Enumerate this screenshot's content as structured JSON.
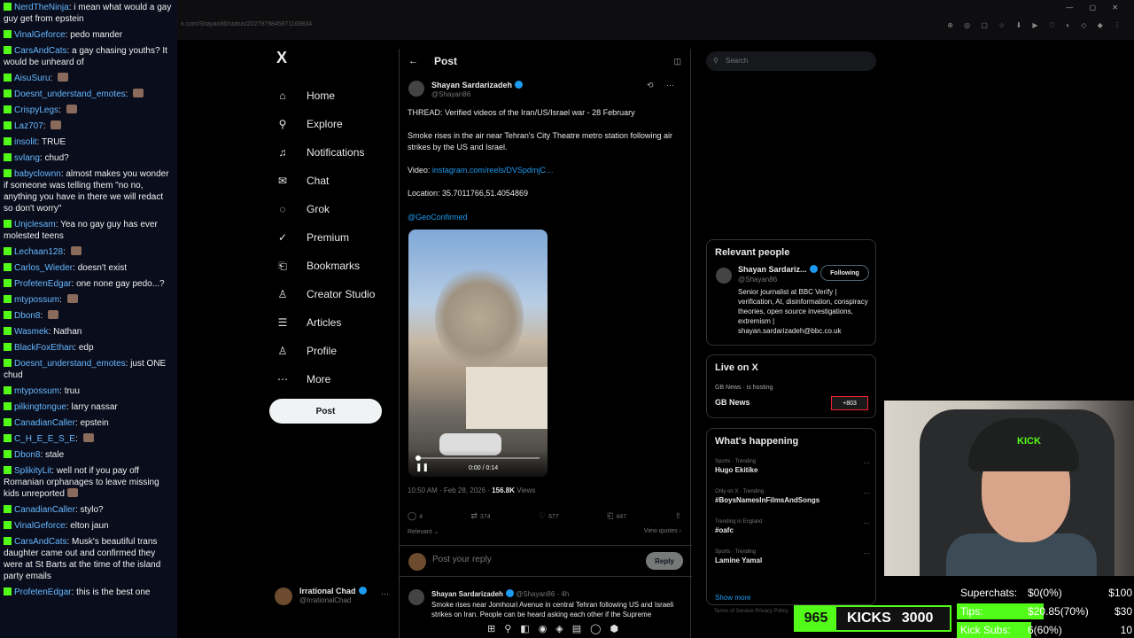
{
  "chat": [
    {
      "user": "NerdTheNinja",
      "text": "i mean what would a gay guy get from epstein",
      "emote": false
    },
    {
      "user": "VinalGeforce",
      "text": "pedo mander",
      "emote": false
    },
    {
      "user": "CarsAndCats",
      "text": "a gay chasing youths? It would be unheard of",
      "emote": false
    },
    {
      "user": "AisuSuru",
      "text": "",
      "emote": true
    },
    {
      "user": "Doesnt_understand_emotes",
      "text": "",
      "emote": true
    },
    {
      "user": "CrispyLegs",
      "text": "",
      "emote": true
    },
    {
      "user": "Laz707",
      "text": "",
      "emote": true
    },
    {
      "user": "insolit",
      "text": "TRUE",
      "emote": false
    },
    {
      "user": "svlang",
      "text": "chud?",
      "emote": false
    },
    {
      "user": "babyclownn",
      "text": "almost makes you wonder if someone was telling them \"no no, anything you have in there we will redact so don't worry\"",
      "emote": false
    },
    {
      "user": "Unjclesam",
      "text": "Yea no gay guy has ever molested teens",
      "emote": false
    },
    {
      "user": "Lechaan128",
      "text": "",
      "emote": true
    },
    {
      "user": "Carlos_Wieder",
      "text": "doesn't exist",
      "emote": false
    },
    {
      "user": "ProfetenEdgar",
      "text": "one none gay pedo...?",
      "emote": false
    },
    {
      "user": "mtypossum",
      "text": "",
      "emote": true
    },
    {
      "user": "Dbon8",
      "text": "",
      "emote": true
    },
    {
      "user": "Wasmek",
      "text": "Nathan",
      "emote": false
    },
    {
      "user": "BlackFoxEthan",
      "text": "edp",
      "emote": false
    },
    {
      "user": "Doesnt_understand_emotes",
      "text": "just ONE chud",
      "emote": false
    },
    {
      "user": "mtypossum",
      "text": "truu",
      "emote": false
    },
    {
      "user": "pilkingtongue",
      "text": "larry nassar",
      "emote": false
    },
    {
      "user": "CanadianCaller",
      "text": "epstein",
      "emote": false
    },
    {
      "user": "C_H_E_E_S_E",
      "text": "",
      "emote": true
    },
    {
      "user": "Dbon8",
      "text": "stale",
      "emote": false
    },
    {
      "user": "SplikityLit",
      "text": "well not if you pay off Romanian orphanages to leave missing kids unreported",
      "emote": true
    },
    {
      "user": "CanadianCaller",
      "text": "stylo?",
      "emote": false
    },
    {
      "user": "VinalGeforce",
      "text": "elton jaun",
      "emote": false
    },
    {
      "user": "CarsAndCats",
      "text": "Musk's beautiful trans daughter came out and confirmed they were at St Barts at the time of the island party emails",
      "emote": false
    },
    {
      "user": "ProfetenEdgar",
      "text": "this is the best one",
      "emote": false
    }
  ],
  "browser": {
    "url": "x.com/Shayan86/status/2027979845871169834",
    "toolbar_icons": "⊕ ◎ ▢ ☆ ⬇ ▶ ♡ ◐ ◇ ◆ ⋮",
    "window_controls": "— ▢ ✕"
  },
  "nav": {
    "logo": "X",
    "items": [
      {
        "label": "Home",
        "icon": "⌂"
      },
      {
        "label": "Explore",
        "icon": "⚲"
      },
      {
        "label": "Notifications",
        "icon": "♫"
      },
      {
        "label": "Chat",
        "icon": "✉"
      },
      {
        "label": "Grok",
        "icon": "◌"
      },
      {
        "label": "Premium",
        "icon": "✓"
      },
      {
        "label": "Bookmarks",
        "icon": "⎗"
      },
      {
        "label": "Creator Studio",
        "icon": "♙"
      },
      {
        "label": "Articles",
        "icon": "☰"
      },
      {
        "label": "Profile",
        "icon": "♙"
      },
      {
        "label": "More",
        "icon": "⋯"
      }
    ],
    "post_button": "Post",
    "account_name": "Irrational Chad",
    "account_handle": "@IrrationalChad"
  },
  "post": {
    "header_title": "Post",
    "back": "←",
    "reader": "◫",
    "author_name": "Shayan Sardarizadeh",
    "author_handle": "@Shayan86",
    "author_icons": "⟲ ⋯",
    "line1": "THREAD: Verified videos of the Iran/US/Israel war - 28 February",
    "line2": "Smoke rises in the air near Tehran's City Theatre metro station following air strikes by the US and Israel.",
    "video_label": "Video: ",
    "video_link": "instagram.com/reels/DVSpdmjC…",
    "location": "Location: 35.7011766,51.4054869",
    "mention": "@GeoConfirmed",
    "video_time": "0:00 / 0:14",
    "video_pause": "❚❚",
    "timestamp": "10:50 AM · Feb 28, 2026 · ",
    "views_count": "156.8K",
    "views_label": " Views",
    "replies": "4",
    "reposts": "374",
    "likes": "677",
    "bookmarks": "447",
    "relevant": "Relevant ⌄",
    "view_quotes": "View quotes ›",
    "reply_placeholder": "Post your reply",
    "reply_button": "Reply",
    "next_name": "Shayan Sardarizadeh",
    "next_meta": " @Shayan86 · 4h",
    "next_text": "Smoke rises near Jomhouri Avenue in central Tehran following US and Israeli strikes on Iran. People can be heard asking each other if the Supreme"
  },
  "right": {
    "search_placeholder": "Search",
    "relevant_title": "Relevant people",
    "rp_name": "Shayan Sardariz...",
    "rp_handle": "@Shayan86",
    "rp_follow": "Following",
    "rp_bio": "Senior journalist at BBC Verify | verification, AI, disinformation, conspiracy theories, open source investigations, extremism | shayan.sardarizadeh@bbc.co.uk",
    "live_title": "Live on X",
    "live_source": "GB News · is hosting",
    "live_name": "GB News",
    "live_count": "+803",
    "happening_title": "What's happening",
    "trends": [
      {
        "ctx": "Sports · Trending",
        "title": "Hugo Ekitike"
      },
      {
        "ctx": "Only on X · Trending",
        "title": "#BoysNamesInFilmsAndSongs"
      },
      {
        "ctx": "Trending in England",
        "title": "#oafc"
      },
      {
        "ctx": "Sports · Trending",
        "title": "Lamine Yamal"
      }
    ],
    "show_more": "Show more",
    "footer": "Terms of Service   Privacy Policy"
  },
  "stream": {
    "cam_text": "KICK",
    "kick_count": "965",
    "kick_label": "KICKS",
    "kick_goal": "3000",
    "goals": [
      {
        "label": "Superchats:",
        "value": "$0(0%)",
        "target": "$100",
        "fill": 0.0
      },
      {
        "label": "Tips:",
        "value": "$20.85(70%)",
        "target": "$30",
        "fill": 0.7
      },
      {
        "label": "Kick Subs:",
        "value": "6(60%)",
        "target": "10",
        "fill": 0.6
      }
    ]
  },
  "taskbar": [
    "⊞",
    "⚲",
    "◧",
    "◉",
    "◈",
    "▤",
    "◯",
    "⬢"
  ],
  "colors": {
    "kick_green": "#53fc18",
    "x_blue": "#1d9bf0"
  }
}
